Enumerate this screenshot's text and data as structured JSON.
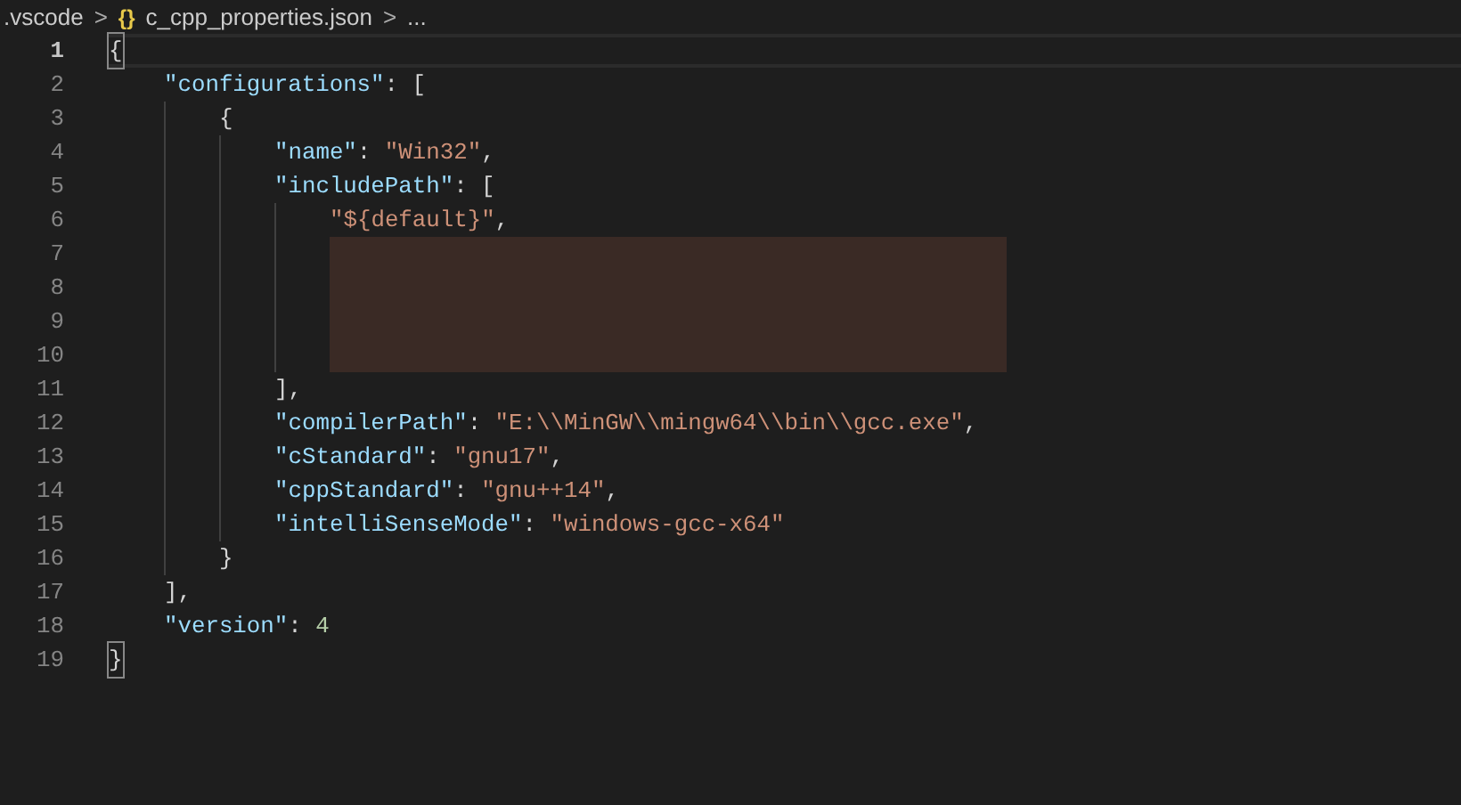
{
  "breadcrumbs": [
    {
      "label": ".vscode"
    },
    {
      "label": "c_cpp_properties.json",
      "icon": "{}"
    },
    {
      "label": "..."
    }
  ],
  "separator": ">",
  "editor": {
    "lines": [
      {
        "number": "1",
        "current": true,
        "tokens": [
          {
            "kind": "punct",
            "text": "{",
            "matched": true
          }
        ],
        "children": [
          {
            "number": "2",
            "current": false,
            "tokens": [
              {
                "kind": "key",
                "text": "\"configurations\""
              },
              {
                "kind": "punct",
                "text": ": ["
              }
            ],
            "children": [
              {
                "number": "3",
                "current": false,
                "tokens": [
                  {
                    "kind": "punct",
                    "text": "{"
                  }
                ],
                "children": [
                  {
                    "number": "4",
                    "current": false,
                    "tokens": [
                      {
                        "kind": "key",
                        "text": "\"name\""
                      },
                      {
                        "kind": "punct",
                        "text": ": "
                      },
                      {
                        "kind": "string",
                        "text": "\"Win32\""
                      },
                      {
                        "kind": "punct",
                        "text": ","
                      }
                    ]
                  },
                  {
                    "number": "5",
                    "current": false,
                    "tokens": [
                      {
                        "kind": "key",
                        "text": "\"includePath\""
                      },
                      {
                        "kind": "punct",
                        "text": ": ["
                      }
                    ],
                    "children": [
                      {
                        "number": "6",
                        "current": false,
                        "tokens": [
                          {
                            "kind": "string",
                            "text": "\"${default}\""
                          },
                          {
                            "kind": "punct",
                            "text": ","
                          }
                        ]
                      },
                      {
                        "number": "7",
                        "current": false,
                        "tokens": [
                          {
                            "kind": "redacted"
                          }
                        ]
                      },
                      {
                        "number": "8",
                        "current": false,
                        "tokens": [
                          {
                            "kind": "redacted"
                          }
                        ]
                      },
                      {
                        "number": "9",
                        "current": false,
                        "tokens": [
                          {
                            "kind": "redacted"
                          }
                        ]
                      },
                      {
                        "number": "10",
                        "current": false,
                        "tokens": [
                          {
                            "kind": "redacted"
                          }
                        ]
                      }
                    ]
                  },
                  {
                    "number": "11",
                    "current": false,
                    "tokens": [
                      {
                        "kind": "punct",
                        "text": "],"
                      }
                    ]
                  },
                  {
                    "number": "12",
                    "current": false,
                    "tokens": [
                      {
                        "kind": "key",
                        "text": "\"compilerPath\""
                      },
                      {
                        "kind": "punct",
                        "text": ": "
                      },
                      {
                        "kind": "string",
                        "text": "\"E:\\\\MinGW\\\\mingw64\\\\bin\\\\gcc.exe\""
                      },
                      {
                        "kind": "punct",
                        "text": ","
                      }
                    ]
                  },
                  {
                    "number": "13",
                    "current": false,
                    "tokens": [
                      {
                        "kind": "key",
                        "text": "\"cStandard\""
                      },
                      {
                        "kind": "punct",
                        "text": ": "
                      },
                      {
                        "kind": "string",
                        "text": "\"gnu17\""
                      },
                      {
                        "kind": "punct",
                        "text": ","
                      }
                    ]
                  },
                  {
                    "number": "14",
                    "current": false,
                    "tokens": [
                      {
                        "kind": "key",
                        "text": "\"cppStandard\""
                      },
                      {
                        "kind": "punct",
                        "text": ": "
                      },
                      {
                        "kind": "string",
                        "text": "\"gnu++14\""
                      },
                      {
                        "kind": "punct",
                        "text": ","
                      }
                    ]
                  },
                  {
                    "number": "15",
                    "current": false,
                    "tokens": [
                      {
                        "kind": "key",
                        "text": "\"intelliSenseMode\""
                      },
                      {
                        "kind": "punct",
                        "text": ": "
                      },
                      {
                        "kind": "string",
                        "text": "\"windows-gcc-x64\""
                      }
                    ]
                  }
                ]
              },
              {
                "number": "16",
                "current": false,
                "tokens": [
                  {
                    "kind": "punct",
                    "text": "}"
                  }
                ]
              }
            ]
          },
          {
            "number": "17",
            "current": false,
            "tokens": [
              {
                "kind": "punct",
                "text": "],"
              }
            ]
          },
          {
            "number": "18",
            "current": false,
            "tokens": [
              {
                "kind": "key",
                "text": "\"version\""
              },
              {
                "kind": "punct",
                "text": ": "
              },
              {
                "kind": "number",
                "text": "4"
              }
            ]
          }
        ]
      },
      {
        "number": "19",
        "current": false,
        "tokens": [
          {
            "kind": "punct",
            "text": "}",
            "matched": true
          }
        ]
      }
    ]
  }
}
